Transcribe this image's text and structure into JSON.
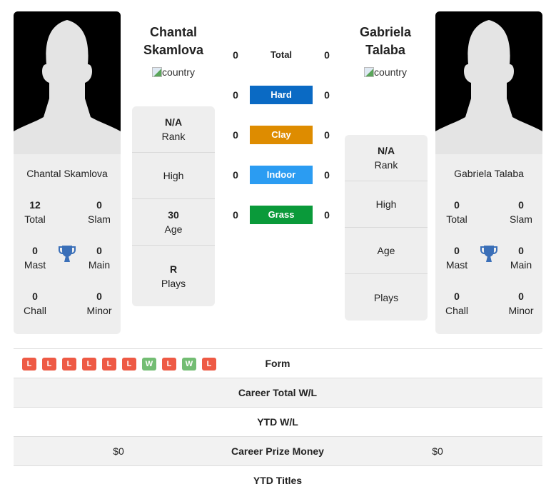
{
  "players": [
    {
      "name_line1": "Chantal",
      "name_line2": "Skamlova",
      "full_name": "Chantal Skamlova",
      "flag_alt": "country",
      "info": {
        "rank_value": "N/A",
        "rank_label": "Rank",
        "high_label": "High",
        "age_value": "30",
        "age_label": "Age",
        "plays_value": "R",
        "plays_label": "Plays"
      },
      "titles": {
        "total": "12",
        "total_label": "Total",
        "slam": "0",
        "slam_label": "Slam",
        "mast": "0",
        "mast_label": "Mast",
        "main": "0",
        "main_label": "Main",
        "chall": "0",
        "chall_label": "Chall",
        "minor": "0",
        "minor_label": "Minor"
      }
    },
    {
      "name_line1": "Gabriela",
      "name_line2": "Talaba",
      "full_name": "Gabriela Talaba",
      "flag_alt": "country",
      "info": {
        "rank_value": "N/A",
        "rank_label": "Rank",
        "high_label": "High",
        "age_label": "Age",
        "plays_label": "Plays"
      },
      "titles": {
        "total": "0",
        "total_label": "Total",
        "slam": "0",
        "slam_label": "Slam",
        "mast": "0",
        "mast_label": "Mast",
        "main": "0",
        "main_label": "Main",
        "chall": "0",
        "chall_label": "Chall",
        "minor": "0",
        "minor_label": "Minor"
      }
    }
  ],
  "surfaces": [
    {
      "label": "Total",
      "left": "0",
      "right": "0",
      "color": ""
    },
    {
      "label": "Hard",
      "left": "0",
      "right": "0",
      "color": "#0a6ac4"
    },
    {
      "label": "Clay",
      "left": "0",
      "right": "0",
      "color": "#de8c00"
    },
    {
      "label": "Indoor",
      "left": "0",
      "right": "0",
      "color": "#2b9cf2"
    },
    {
      "label": "Grass",
      "left": "0",
      "right": "0",
      "color": "#0a9a3a"
    }
  ],
  "form": {
    "label": "Form",
    "results": [
      "L",
      "L",
      "L",
      "L",
      "L",
      "L",
      "W",
      "L",
      "W",
      "L"
    ],
    "colors": {
      "L": "#ee5a45",
      "W": "#73bd73"
    }
  },
  "table": [
    {
      "label": "Career Total W/L",
      "left": "",
      "right": ""
    },
    {
      "label": "YTD W/L",
      "left": "",
      "right": ""
    },
    {
      "label": "Career Prize Money",
      "left": "$0",
      "right": "$0"
    },
    {
      "label": "YTD Titles",
      "left": "",
      "right": ""
    }
  ]
}
